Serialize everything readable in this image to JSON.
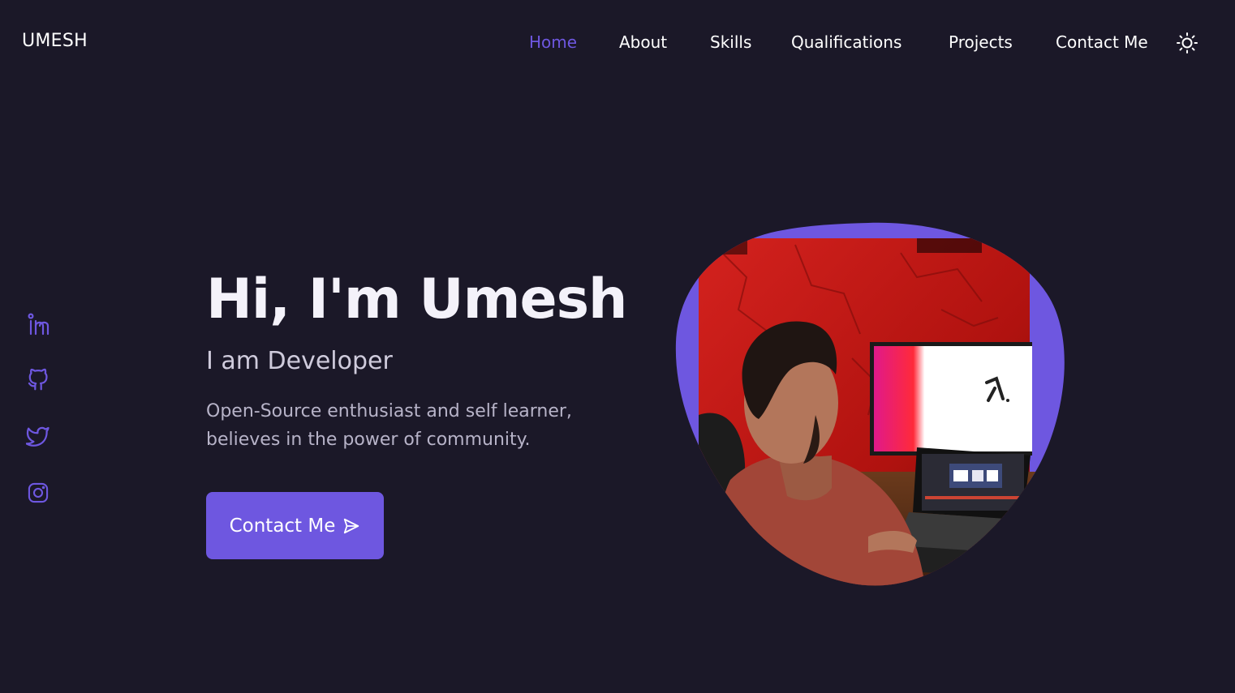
{
  "brand": {
    "logo_text": "UMESH"
  },
  "nav": {
    "items": [
      {
        "label": "Home",
        "active": true
      },
      {
        "label": "About",
        "active": false
      },
      {
        "label": "Skills",
        "active": false
      },
      {
        "label": "Qualifications",
        "active": false
      },
      {
        "label": "Projects",
        "active": false
      },
      {
        "label": "Contact Me",
        "active": false
      }
    ],
    "theme_toggle_icon": "sun-icon"
  },
  "social": {
    "icons": [
      "linkedin-icon",
      "github-icon",
      "twitter-icon",
      "instagram-icon"
    ]
  },
  "hero": {
    "title": "Hi, I'm Umesh",
    "subtitle": "I am Developer",
    "description_lines": [
      "Open-Source enthusiast and self learner,",
      "believes in the power of community."
    ],
    "cta_label": "Contact Me",
    "cta_icon": "send-icon",
    "image_icon": "developer-photo"
  },
  "colors": {
    "background": "#1b1828",
    "accent": "#6e57e0",
    "text": "#ffffff",
    "muted_text": "#b7b3c8"
  }
}
